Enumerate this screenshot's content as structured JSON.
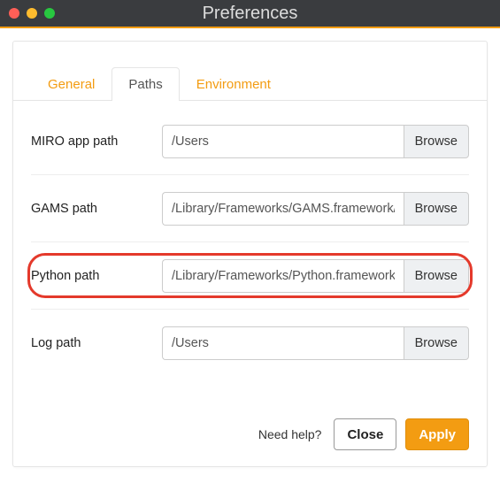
{
  "window": {
    "title": "Preferences"
  },
  "tabs": {
    "general": "General",
    "paths": "Paths",
    "environment": "Environment"
  },
  "fields": {
    "miro": {
      "label": "MIRO app path",
      "value": "/Users",
      "browse": "Browse"
    },
    "gams": {
      "label": "GAMS path",
      "value": "/Library/Frameworks/GAMS.framework/Versions",
      "browse": "Browse"
    },
    "python": {
      "label": "Python path",
      "value": "/Library/Frameworks/Python.framework/Versions",
      "browse": "Browse"
    },
    "log": {
      "label": "Log path",
      "value": "/Users",
      "browse": "Browse"
    }
  },
  "footer": {
    "help": "Need help?",
    "close": "Close",
    "apply": "Apply"
  }
}
